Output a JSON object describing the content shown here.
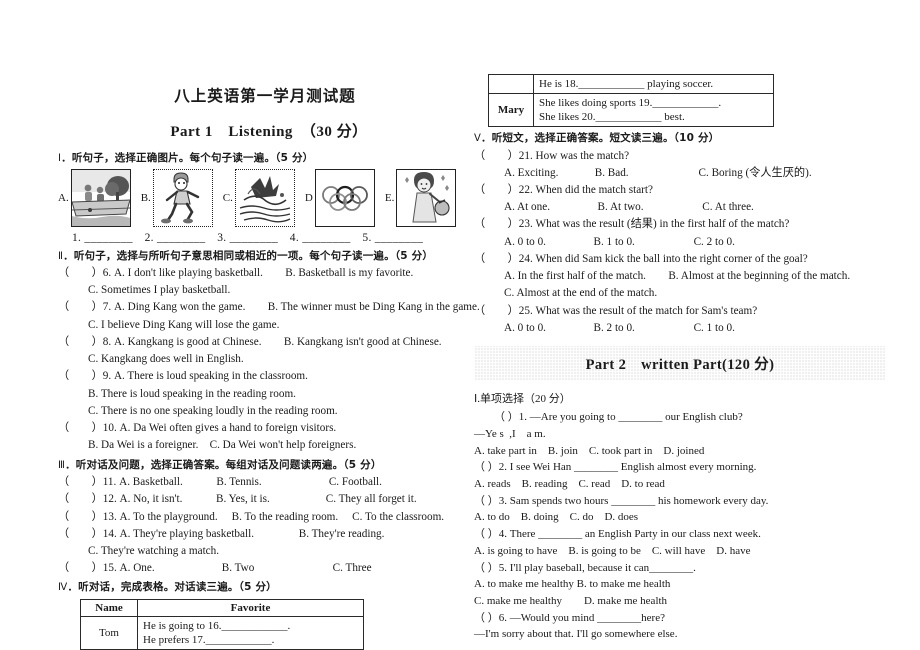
{
  "document": {
    "title": "八上英语第一学月测试题",
    "part1_title": "Part 1　Listening　（30 分）",
    "part2_title": "Part 2　written Part(120 分)"
  },
  "left_column": {
    "section_1": {
      "label": "Ⅰ",
      "instruction": "．听句子，选择正确图片。每个句子读一遍。（5 分）",
      "pictures": [
        {
          "label": "A.",
          "icon": "kids-on-boat-icon"
        },
        {
          "label": "B.",
          "icon": "running-boy-icon"
        },
        {
          "label": "C.",
          "icon": "swimming-splash-icon"
        },
        {
          "label": "D",
          "icon": "olympic-rings-icon"
        },
        {
          "label": "E.",
          "icon": "woman-singing-icon"
        }
      ],
      "answer_blanks": "1. ________　2. ________　3. ________　4. ________　5. ________"
    },
    "section_2": {
      "label": "Ⅱ",
      "instruction": "．听句子，选择与所听句子意思相同或相近的一项。每个句子读一遍。（5 分）",
      "questions": [
        {
          "number": "6",
          "lines": [
            "（　　）6. A. I don't like playing basketball.　　B. Basketball is my favorite.",
            "C. Sometimes I play basketball."
          ]
        },
        {
          "number": "7",
          "lines": [
            "（　　）7. A. Ding Kang won the game.　　B. The winner must be Ding Kang in the game.",
            "C. I believe Ding Kang will lose the game."
          ]
        },
        {
          "number": "8",
          "lines": [
            "（　　）8. A. Kangkang is good at Chinese.　　B. Kangkang isn't good at Chinese.",
            "C. Kangkang does well in English."
          ]
        },
        {
          "number": "9",
          "lines": [
            "（　　）9. A. There is loud speaking in the classroom.",
            "B. There is loud speaking in the reading room.",
            "C. There is no one speaking loudly in the reading room."
          ]
        },
        {
          "number": "10",
          "lines": [
            "（　　）10. A. Da Wei often gives a hand to foreign visitors.",
            "B. Da Wei is a foreigner.　C. Da Wei won't help foreigners."
          ]
        }
      ]
    },
    "section_3": {
      "label": "Ⅲ",
      "instruction": "．听对话及问题，选择正确答案。每组对话及问题读两遍。（5 分）",
      "questions": [
        {
          "number": "11",
          "lines": [
            "（　　）11. A. Basketball.　　　B. Tennis.　　　　　　C. Football."
          ]
        },
        {
          "number": "12",
          "lines": [
            "（　　）12. A. No, it isn't.　　　B. Yes, it is.　　　　　C. They all forget it."
          ]
        },
        {
          "number": "13",
          "lines": [
            "（　　）13. A. To the playground.　 B. To the reading room.　 C. To the classroom."
          ]
        },
        {
          "number": "14",
          "lines": [
            "（　　）14. A. They're playing basketball.　　　　B. They're reading.",
            "C. They're watching a match."
          ]
        },
        {
          "number": "15",
          "lines": [
            "（　　）15. A. One.　　　　　　B. Two　　　　　　　C. Three"
          ]
        }
      ]
    },
    "section_4": {
      "label": "Ⅳ",
      "instruction": "．听对话，完成表格。对话读三遍。（5 分）",
      "table": {
        "headers": [
          "Name",
          "Favorite"
        ],
        "rows": [
          {
            "name": "Tom",
            "lines": [
              "He is going to 16.____________.",
              "He prefers 17.____________."
            ]
          }
        ]
      }
    }
  },
  "right_column": {
    "table_continued": {
      "rows": [
        {
          "name": "",
          "lines": [
            "He is 18.____________ playing soccer."
          ]
        },
        {
          "name": "Mary",
          "lines": [
            "She likes doing sports 19.____________.",
            "She likes 20.____________ best."
          ]
        }
      ]
    },
    "section_5": {
      "label": "Ⅴ",
      "instruction": "．听短文，选择正确答案。短文读三遍。（10 分）",
      "questions": [
        {
          "number": "21",
          "lines": [
            "（　　）21. How was the match?",
            "A. Exciting.　　　 B. Bad.　　　　　　 C. Boring (令人生厌的)."
          ]
        },
        {
          "number": "22",
          "lines": [
            "（　　）22. When did the match start?",
            "A. At one.　　　　 B. At two.　　　　　 C. At three."
          ]
        },
        {
          "number": "23",
          "lines": [
            "（　　）23. What was the result (结果) in the first half of the match?",
            "A. 0 to 0.　　　　 B. 1 to 0.　　　　　 C. 2 to 0."
          ]
        },
        {
          "number": "24",
          "lines": [
            "（　　）24. When did Sam kick the ball into the right corner of the goal?",
            "A. In the first half of the match.　　B. Almost at the beginning of the match.",
            "C. Almost at the end of the match."
          ]
        },
        {
          "number": "25",
          "lines": [
            "（　　）25. What was the result of the match for Sam's team?",
            "A. 0 to 0.　　　　 B. 2 to 0.　　　　　 C. 1 to 0."
          ]
        }
      ]
    },
    "section_written_1": {
      "label": "Ⅰ.单项选择（20 分）",
      "questions": [
        {
          "number": "1",
          "lines": [
            "（ ）1. —Are you going to ________ our English club?",
            "—Ye s  ,I    a m.",
            "A. take part in　B. join　C. took part in　D. joined"
          ]
        },
        {
          "number": "2",
          "lines": [
            "（ ）2. I see Wei Han ________ English almost every morning.",
            "A. reads　B. reading　C. read　D. to read"
          ]
        },
        {
          "number": "3",
          "lines": [
            "（ ）3. Sam spends two hours ________ his homework every day.",
            "A. to do　B. doing　C. do　D. does"
          ]
        },
        {
          "number": "4",
          "lines": [
            "（ ）4. There ________ an English Party in our class next week.",
            "A. is going to have　B. is going to be　C. will have　D. have"
          ]
        },
        {
          "number": "5",
          "lines": [
            "（ ）5. I'll play baseball, because it can________.",
            "A. to make me healthy B. to make me health",
            "C. make me healthy　　D. make me health"
          ]
        },
        {
          "number": "6",
          "lines": [
            "（ ）6. —Would you mind ________here?",
            "—I'm sorry about that. I'll go somewhere else."
          ]
        }
      ]
    }
  }
}
